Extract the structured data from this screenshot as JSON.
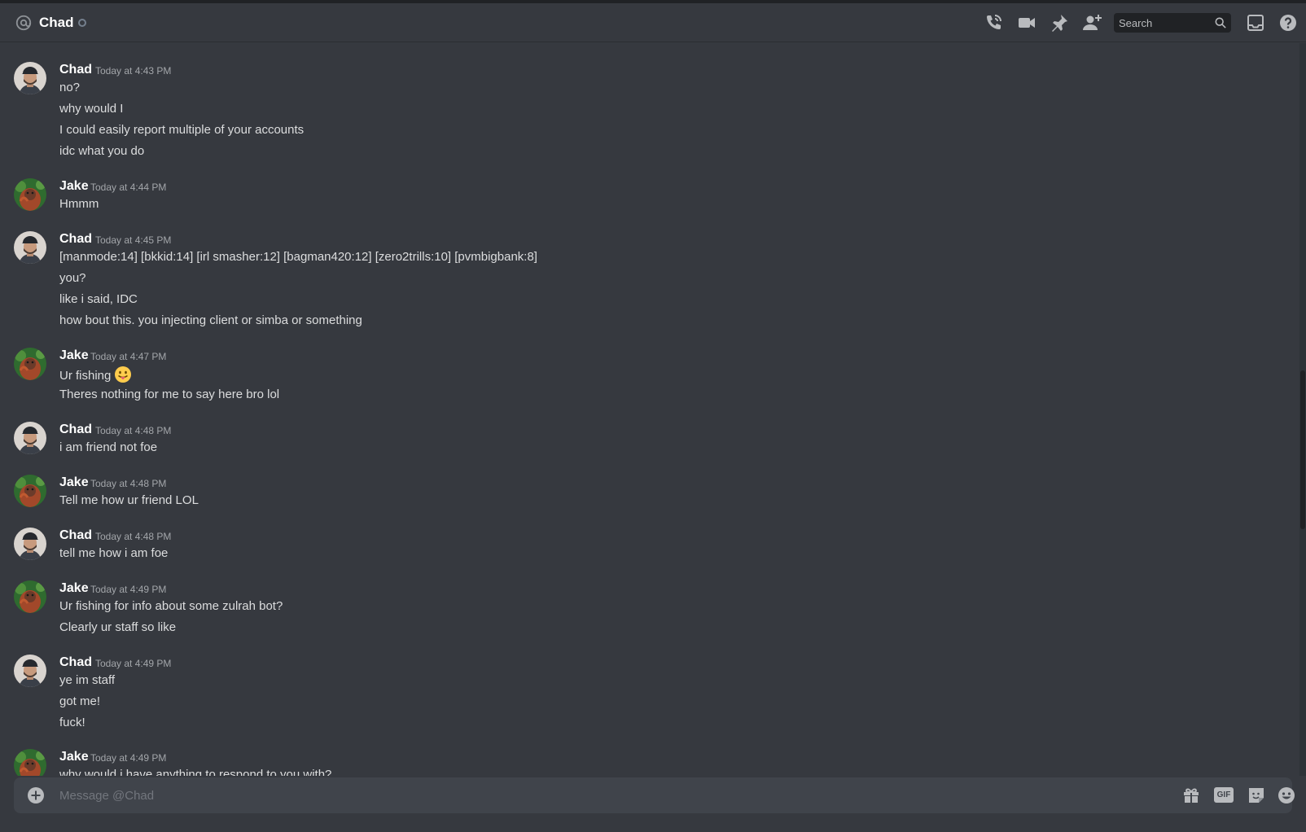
{
  "header": {
    "title": "Chad",
    "search_placeholder": "Search"
  },
  "icons": {
    "call": "phone-call-icon",
    "video": "video-camera-icon",
    "pin": "pin-icon",
    "add_friend": "add-friend-icon",
    "inbox": "inbox-icon",
    "help": "help-icon"
  },
  "colors": {
    "background": "#36393f",
    "header_text": "#ffffff",
    "message_text": "#dcddde",
    "timestamp": "#a3a6aa",
    "composer": "#40444b"
  },
  "messages": [
    {
      "author": "Chad",
      "timestamp": "Today at 4:43 PM",
      "lines": [
        "no?",
        "why would I",
        "I could easily report multiple of your accounts",
        "idc what you do"
      ]
    },
    {
      "author": "Jake",
      "timestamp": "Today at 4:44 PM",
      "lines": [
        "Hmmm"
      ]
    },
    {
      "author": "Chad",
      "timestamp": "Today at 4:45 PM",
      "lines": [
        "[manmode:14] [bkkid:14] [irl smasher:12] [bagman420:12] [zero2trills:10] [pvmbigbank:8]",
        "you?",
        "like i said, IDC",
        "how bout this. you injecting client or simba or something"
      ]
    },
    {
      "author": "Jake",
      "timestamp": "Today at 4:47 PM",
      "lines": [
        "Ur fishing",
        "Theres nothing for me to say here bro lol"
      ]
    },
    {
      "author": "Chad",
      "timestamp": "Today at 4:48 PM",
      "lines": [
        "i am friend not foe"
      ]
    },
    {
      "author": "Jake",
      "timestamp": "Today at 4:48 PM",
      "lines": [
        "Tell me how ur friend LOL"
      ]
    },
    {
      "author": "Chad",
      "timestamp": "Today at 4:48 PM",
      "lines": [
        "tell me how i am foe"
      ]
    },
    {
      "author": "Jake",
      "timestamp": "Today at 4:49 PM",
      "lines": [
        "Ur fishing for info about some zulrah bot?",
        "Clearly ur staff so like"
      ]
    },
    {
      "author": "Chad",
      "timestamp": "Today at 4:49 PM",
      "lines": [
        "ye im staff",
        "got me!",
        "fuck!"
      ]
    },
    {
      "author": "Jake",
      "timestamp": "Today at 4:49 PM",
      "lines": [
        "why would i have anything to respond to you with?"
      ]
    }
  ],
  "composer": {
    "placeholder": "Message @Chad",
    "gif_label": "GIF"
  }
}
